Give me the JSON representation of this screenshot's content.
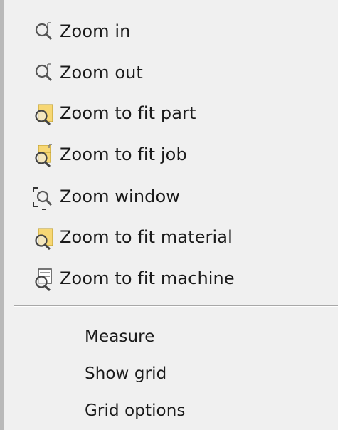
{
  "menu": {
    "zoom_items": [
      {
        "label": "Zoom in",
        "icon": "zoom-in-icon"
      },
      {
        "label": "Zoom out",
        "icon": "zoom-out-icon"
      },
      {
        "label": "Zoom to fit part",
        "icon": "zoom-fit-part-icon"
      },
      {
        "label": "Zoom to fit job",
        "icon": "zoom-fit-job-icon"
      },
      {
        "label": "Zoom window",
        "icon": "zoom-window-icon"
      },
      {
        "label": "Zoom to fit material",
        "icon": "zoom-fit-material-icon"
      },
      {
        "label": "Zoom to fit machine",
        "icon": "zoom-fit-machine-icon"
      }
    ],
    "other_items": [
      {
        "label": "Measure"
      },
      {
        "label": "Show grid"
      },
      {
        "label": "Grid options"
      }
    ],
    "colors": {
      "background": "#f0f0f0",
      "text": "#1a1a1a",
      "icon_yellow": "#f7d774",
      "icon_outline": "#444444"
    }
  }
}
